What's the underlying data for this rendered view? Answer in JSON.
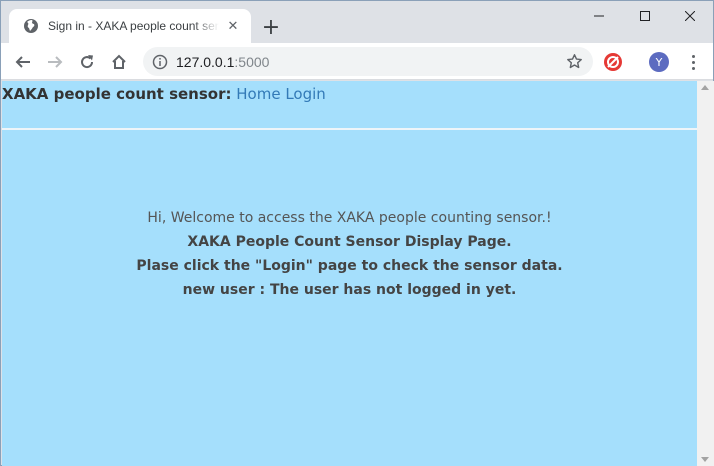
{
  "browser": {
    "tab_title": "Sign in - XAKA people count sensor",
    "tab_close": "✕",
    "new_tab": "+",
    "url_host": "127.0.0.1",
    "url_port": ":5000",
    "avatar_letter": "Y"
  },
  "colors": {
    "page_background": "#a5dffc",
    "link": "#337ab7"
  },
  "navbar": {
    "brand": "XAKA people count sensor:",
    "links": [
      "Home",
      "Login"
    ]
  },
  "content": {
    "welcome": "Hi, Welcome to access the XAKA people counting sensor.!",
    "title": "XAKA People Count Sensor Display Page.",
    "instruction": "Plase click the \"Login\" page to check the sensor data.",
    "status": "new user : The user has not logged in yet."
  }
}
